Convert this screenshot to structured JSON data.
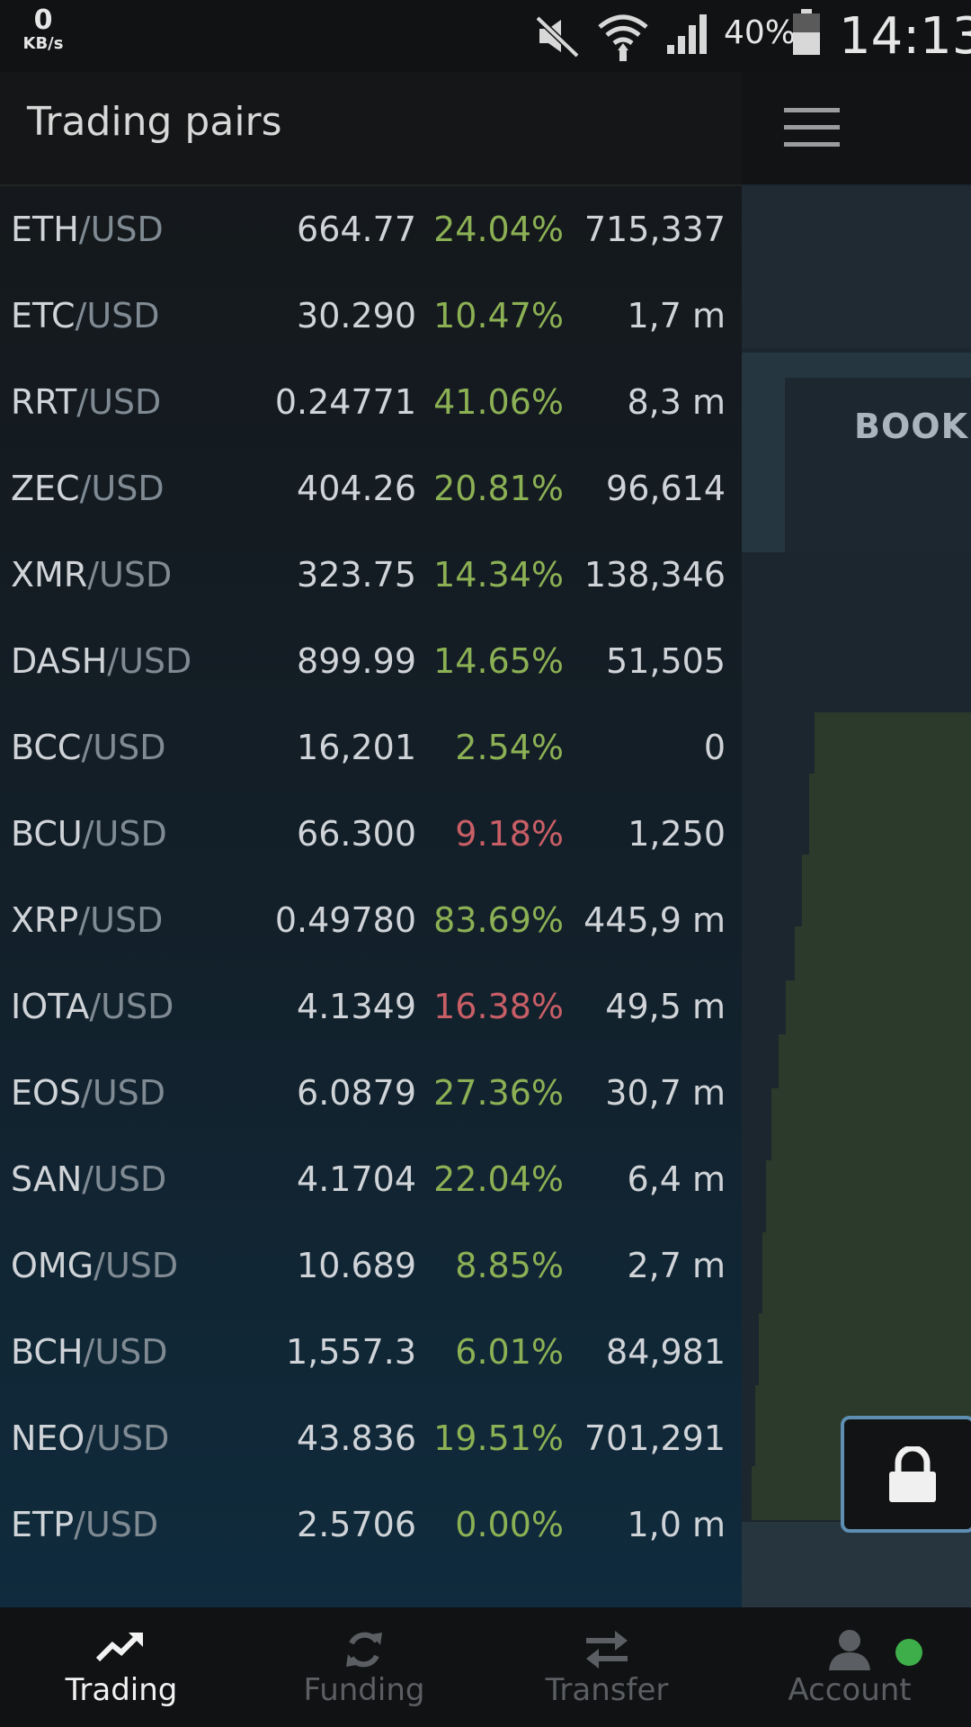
{
  "status_bar": {
    "net_speed_value": "0",
    "net_speed_unit": "KB/s",
    "battery": "40%",
    "time": "14:13",
    "icons": [
      "mute-icon",
      "wifi-icon",
      "signal-icon",
      "battery-icon"
    ]
  },
  "drawer": {
    "title": "Trading pairs",
    "pairs": [
      {
        "base": "ETH",
        "quote": "/USD",
        "price": "664.77",
        "change": "24.04%",
        "direction": "up",
        "volume": "715,337"
      },
      {
        "base": "ETC",
        "quote": "/USD",
        "price": "30.290",
        "change": "10.47%",
        "direction": "up",
        "volume": "1,7 m"
      },
      {
        "base": "RRT",
        "quote": "/USD",
        "price": "0.24771",
        "change": "41.06%",
        "direction": "up",
        "volume": "8,3 m"
      },
      {
        "base": "ZEC",
        "quote": "/USD",
        "price": "404.26",
        "change": "20.81%",
        "direction": "up",
        "volume": "96,614"
      },
      {
        "base": "XMR",
        "quote": "/USD",
        "price": "323.75",
        "change": "14.34%",
        "direction": "up",
        "volume": "138,346"
      },
      {
        "base": "DASH",
        "quote": "/USD",
        "price": "899.99",
        "change": "14.65%",
        "direction": "up",
        "volume": "51,505"
      },
      {
        "base": "BCC",
        "quote": "/USD",
        "price": "16,201",
        "change": "2.54%",
        "direction": "up",
        "volume": "0"
      },
      {
        "base": "BCU",
        "quote": "/USD",
        "price": "66.300",
        "change": "9.18%",
        "direction": "down",
        "volume": "1,250"
      },
      {
        "base": "XRP",
        "quote": "/USD",
        "price": "0.49780",
        "change": "83.69%",
        "direction": "up",
        "volume": "445,9 m"
      },
      {
        "base": "IOTA",
        "quote": "/USD",
        "price": "4.1349",
        "change": "16.38%",
        "direction": "down",
        "volume": "49,5 m"
      },
      {
        "base": "EOS",
        "quote": "/USD",
        "price": "6.0879",
        "change": "27.36%",
        "direction": "up",
        "volume": "30,7 m"
      },
      {
        "base": "SAN",
        "quote": "/USD",
        "price": "4.1704",
        "change": "22.04%",
        "direction": "up",
        "volume": "6,4 m"
      },
      {
        "base": "OMG",
        "quote": "/USD",
        "price": "10.689",
        "change": "8.85%",
        "direction": "up",
        "volume": "2,7 m"
      },
      {
        "base": "BCH",
        "quote": "/USD",
        "price": "1,557.3",
        "change": "6.01%",
        "direction": "up",
        "volume": "84,981"
      },
      {
        "base": "NEO",
        "quote": "/USD",
        "price": "43.836",
        "change": "19.51%",
        "direction": "up",
        "volume": "701,291"
      },
      {
        "base": "ETP",
        "quote": "/USD",
        "price": "2.5706",
        "change": "0.00%",
        "direction": "up",
        "volume": "1,0 m"
      }
    ]
  },
  "background_panel": {
    "tab_label": "BOOK",
    "menu_icon": "hamburger-menu-icon",
    "lock_icon": "lock-icon"
  },
  "bottom_nav": {
    "items": [
      {
        "label": "Trading",
        "icon": "trending-up-icon",
        "active": true
      },
      {
        "label": "Funding",
        "icon": "refresh-icon",
        "active": false
      },
      {
        "label": "Transfer",
        "icon": "swap-arrows-icon",
        "active": false
      },
      {
        "label": "Account",
        "icon": "user-icon",
        "active": false
      }
    ],
    "online_indicator_color": "#3dae49"
  },
  "colors": {
    "positive": "#8cb054",
    "negative": "#c85e66",
    "accent_border": "#5e8eb2",
    "depth_fill": "#2c3a2c"
  }
}
